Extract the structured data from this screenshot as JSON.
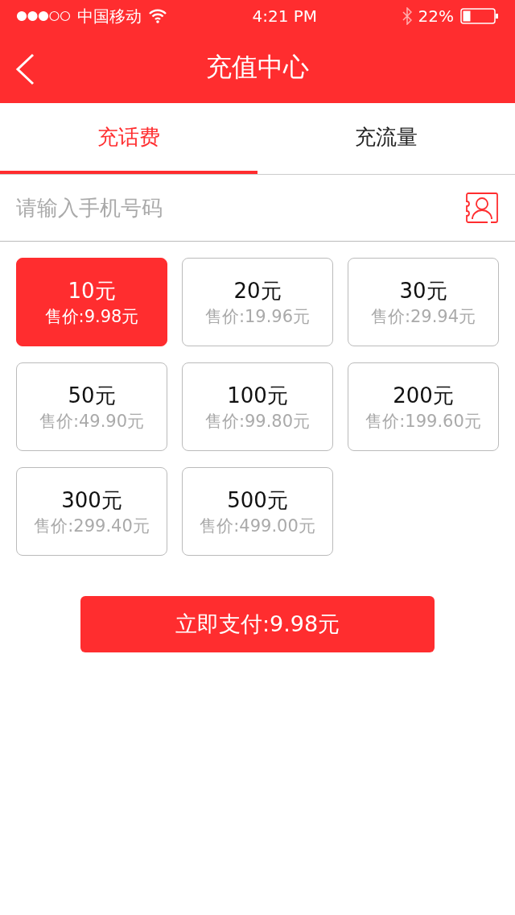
{
  "status_bar": {
    "carrier": "中国移动",
    "time": "4:21 PM",
    "battery": "22%"
  },
  "nav": {
    "title": "充值中心"
  },
  "tabs": [
    {
      "label": "充话费",
      "selected": true
    },
    {
      "label": "充流量",
      "selected": false
    }
  ],
  "phone_field": {
    "placeholder": "请输入手机号码"
  },
  "options": [
    {
      "amount": "10元",
      "price": "售价:9.98元",
      "selected": true
    },
    {
      "amount": "20元",
      "price": "售价:19.96元",
      "selected": false
    },
    {
      "amount": "30元",
      "price": "售价:29.94元",
      "selected": false
    },
    {
      "amount": "50元",
      "price": "售价:49.90元",
      "selected": false
    },
    {
      "amount": "100元",
      "price": "售价:99.80元",
      "selected": false
    },
    {
      "amount": "200元",
      "price": "售价:199.60元",
      "selected": false
    },
    {
      "amount": "300元",
      "price": "售价:299.40元",
      "selected": false
    },
    {
      "amount": "500元",
      "price": "售价:499.00元",
      "selected": false
    }
  ],
  "pay_button": "立即支付:9.98元"
}
